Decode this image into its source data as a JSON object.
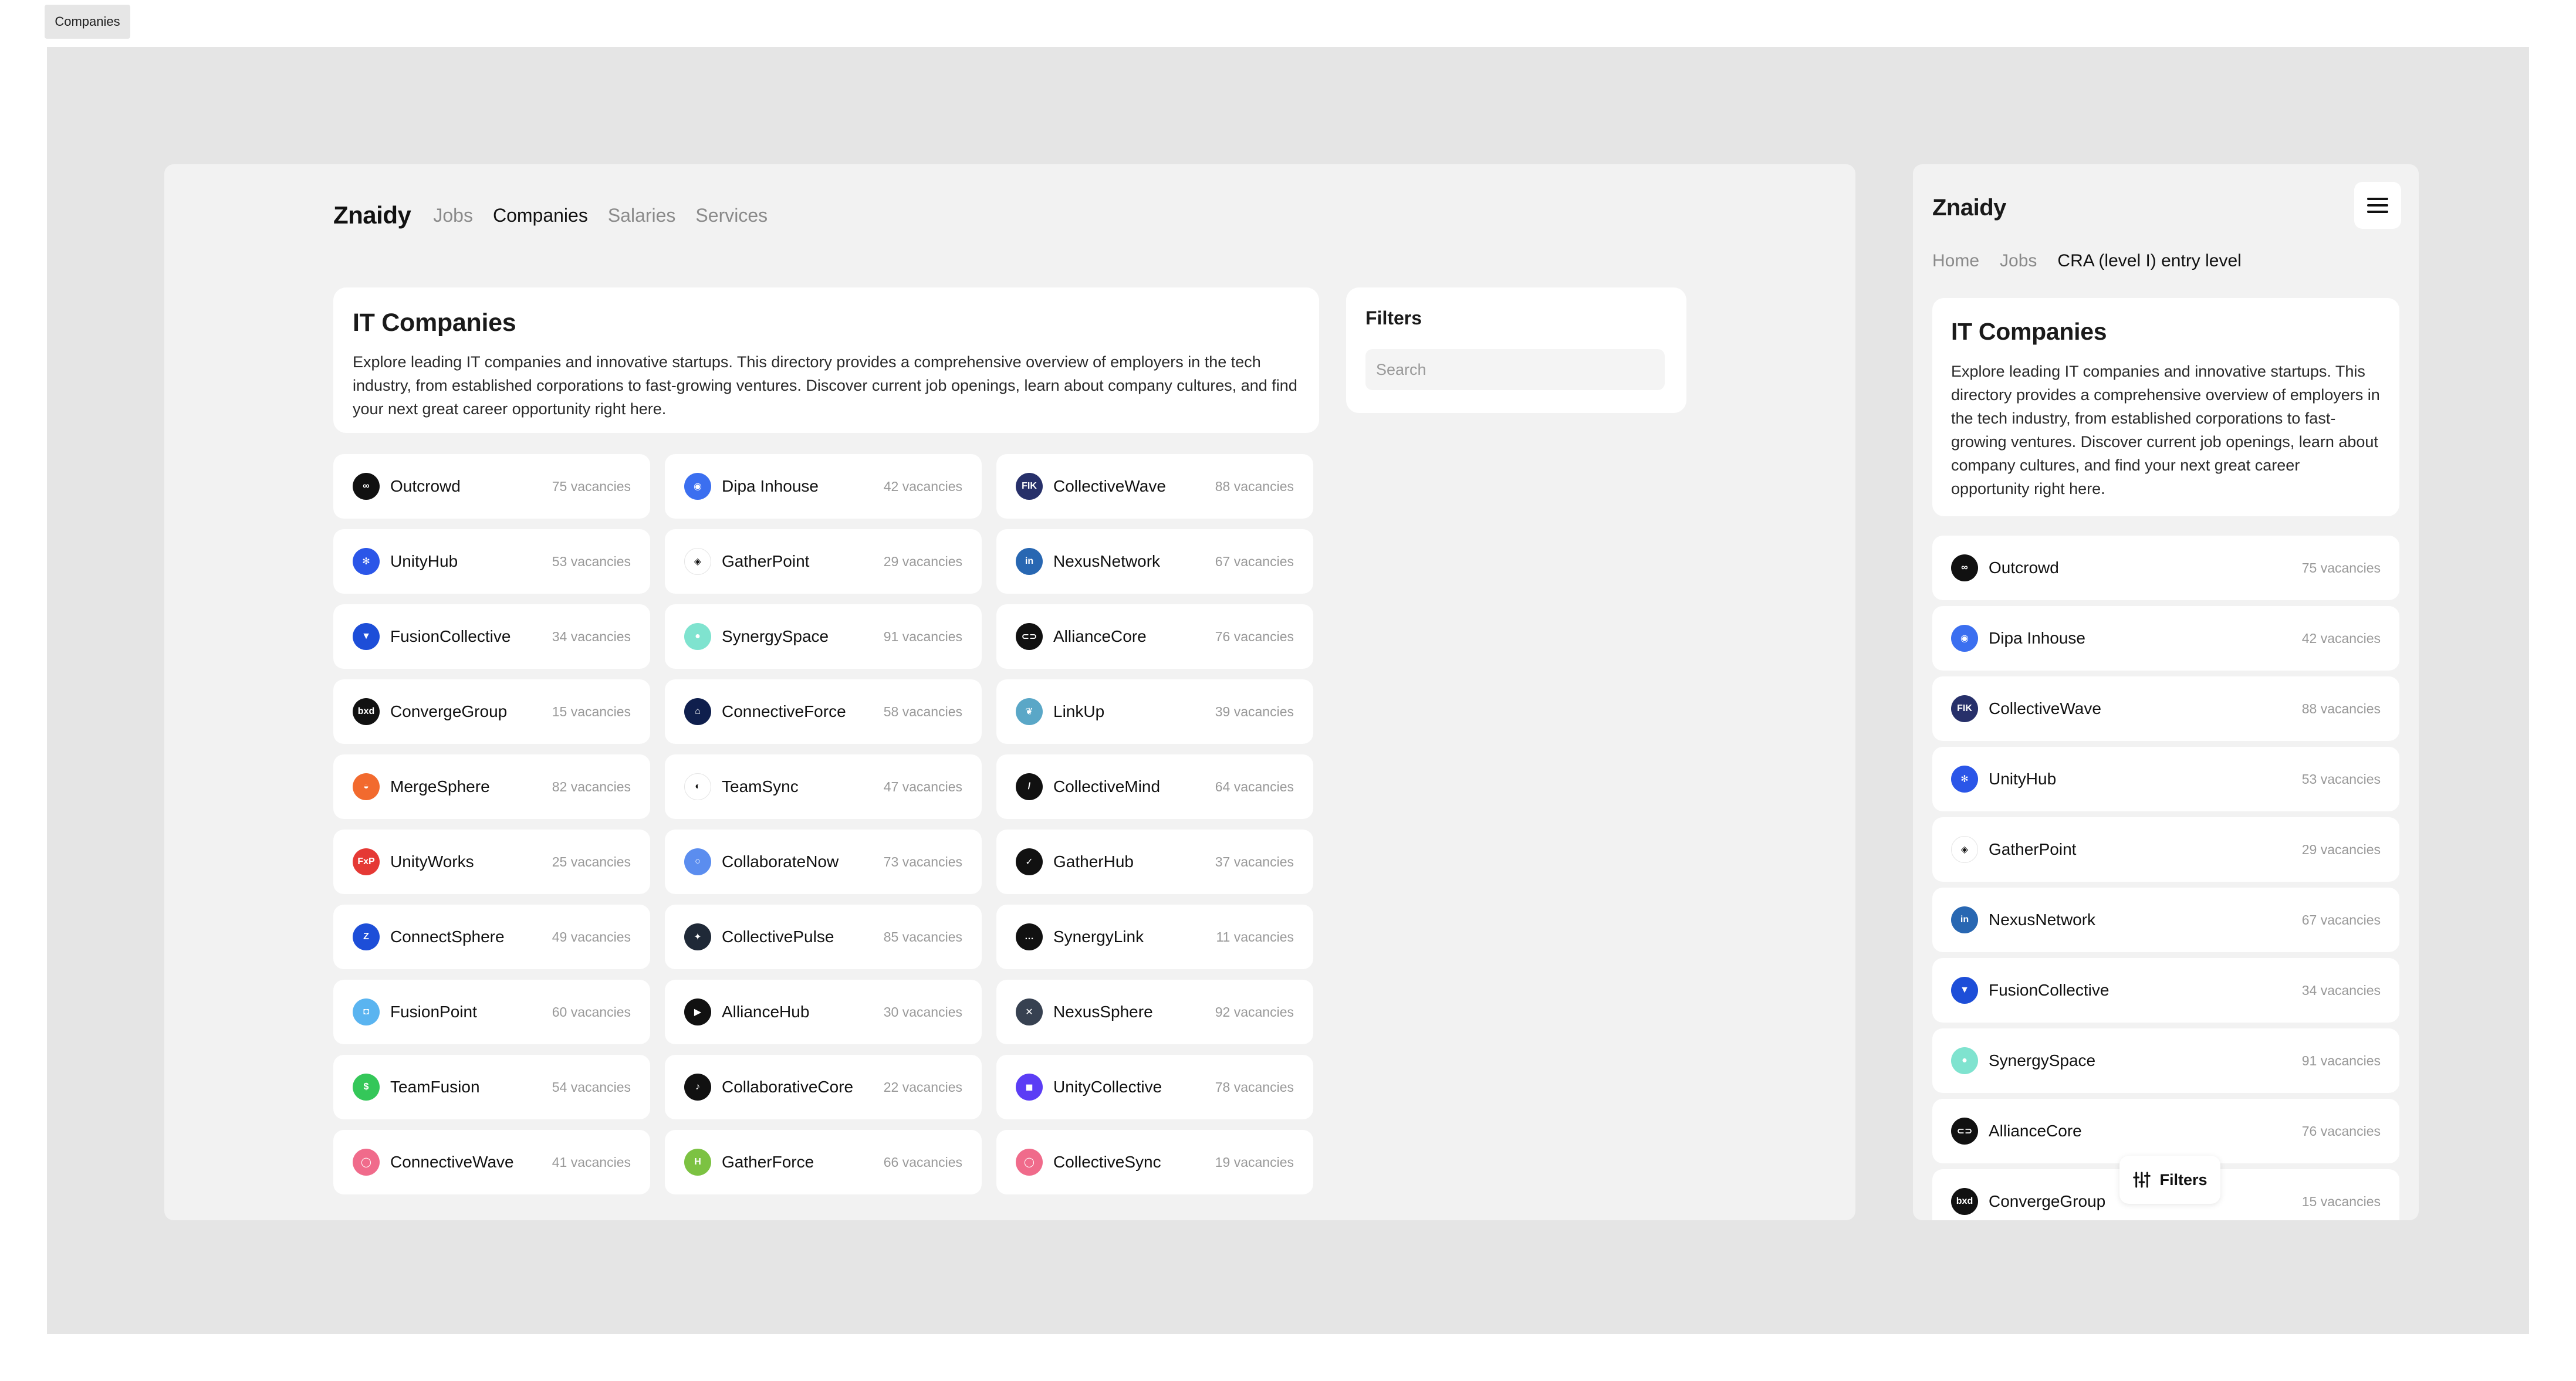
{
  "frame_label": "Companies",
  "desktop": {
    "logo": "Znaidy",
    "nav": [
      {
        "label": "Jobs",
        "active": false
      },
      {
        "label": "Companies",
        "active": true
      },
      {
        "label": "Salaries",
        "active": false
      },
      {
        "label": "Services",
        "active": false
      }
    ],
    "title": "IT Companies",
    "description": "Explore leading IT companies and innovative startups. This directory provides a comprehensive overview of employers in the tech industry, from established corporations to fast-growing ventures. Discover current job openings, learn about company cultures, and find your next great career opportunity right here.",
    "filters": {
      "title": "Filters",
      "search_placeholder": "Search"
    },
    "companies": [
      {
        "name": "Outcrowd",
        "vacancies": "75 vacancies",
        "icon": "infinity-logo-icon",
        "color": "#111111",
        "glyph": "∞"
      },
      {
        "name": "Dipa Inhouse",
        "vacancies": "42 vacancies",
        "icon": "ring-logo-icon",
        "color": "#3b6ff0",
        "glyph": "◉"
      },
      {
        "name": "CollectiveWave",
        "vacancies": "88 vacancies",
        "icon": "fik-logo-icon",
        "color": "#27306a",
        "glyph": "FIK"
      },
      {
        "name": "UnityHub",
        "vacancies": "53 vacancies",
        "icon": "asterisk-logo-icon",
        "color": "#2b56e8",
        "glyph": "✻"
      },
      {
        "name": "GatherPoint",
        "vacancies": "29 vacancies",
        "icon": "diamond-logo-icon",
        "color": "#ffffff",
        "glyph": "◈"
      },
      {
        "name": "NexusNetwork",
        "vacancies": "67 vacancies",
        "icon": "linkedin-logo-icon",
        "color": "#2867b2",
        "glyph": "in"
      },
      {
        "name": "FusionCollective",
        "vacancies": "34 vacancies",
        "icon": "shield-logo-icon",
        "color": "#1d4ed8",
        "glyph": "▼"
      },
      {
        "name": "SynergySpace",
        "vacancies": "91 vacancies",
        "icon": "mint-logo-icon",
        "color": "#7fe3cf",
        "glyph": "●"
      },
      {
        "name": "AllianceCore",
        "vacancies": "76 vacancies",
        "icon": "link-logo-icon",
        "color": "#111111",
        "glyph": "⊂⊃"
      },
      {
        "name": "ConvergeGroup",
        "vacancies": "15 vacancies",
        "icon": "text-logo-icon",
        "color": "#111111",
        "glyph": "bxd"
      },
      {
        "name": "ConnectiveForce",
        "vacancies": "58 vacancies",
        "icon": "mountain-logo-icon",
        "color": "#0f1f4d",
        "glyph": "⌂"
      },
      {
        "name": "LinkUp",
        "vacancies": "39 vacancies",
        "icon": "bird-logo-icon",
        "color": "#5aa7c7",
        "glyph": "❦"
      },
      {
        "name": "MergeSphere",
        "vacancies": "82 vacancies",
        "icon": "orange-logo-icon",
        "color": "#f26a2e",
        "glyph": "◒"
      },
      {
        "name": "TeamSync",
        "vacancies": "47 vacancies",
        "icon": "leaf-logo-icon",
        "color": "#ffffff",
        "glyph": "◐"
      },
      {
        "name": "CollectiveMind",
        "vacancies": "64 vacancies",
        "icon": "slash-logo-icon",
        "color": "#111111",
        "glyph": "/"
      },
      {
        "name": "UnityWorks",
        "vacancies": "25 vacancies",
        "icon": "red-logo-icon",
        "color": "#e53935",
        "glyph": "FxP"
      },
      {
        "name": "CollaborateNow",
        "vacancies": "73 vacancies",
        "icon": "gradient-logo-icon",
        "color": "#5b8def",
        "glyph": "○"
      },
      {
        "name": "GatherHub",
        "vacancies": "37 vacancies",
        "icon": "swoosh-logo-icon",
        "color": "#111111",
        "glyph": "✓"
      },
      {
        "name": "ConnectSphere",
        "vacancies": "49 vacancies",
        "icon": "blue-z-logo-icon",
        "color": "#1d4ed8",
        "glyph": "Z"
      },
      {
        "name": "CollectivePulse",
        "vacancies": "85 vacancies",
        "icon": "spark-logo-icon",
        "color": "#1f2937",
        "glyph": "✦"
      },
      {
        "name": "SynergyLink",
        "vacancies": "11 vacancies",
        "icon": "dark-logo-icon",
        "color": "#111111",
        "glyph": "…"
      },
      {
        "name": "FusionPoint",
        "vacancies": "60 vacancies",
        "icon": "bubble-logo-icon",
        "color": "#5ab4f0",
        "glyph": "◘"
      },
      {
        "name": "AllianceHub",
        "vacancies": "30 vacancies",
        "icon": "play-logo-icon",
        "color": "#111111",
        "glyph": "▶"
      },
      {
        "name": "NexusSphere",
        "vacancies": "92 vacancies",
        "icon": "cross-logo-icon",
        "color": "#374151",
        "glyph": "✕"
      },
      {
        "name": "TeamFusion",
        "vacancies": "54 vacancies",
        "icon": "dollar-logo-icon",
        "color": "#34c759",
        "glyph": "$"
      },
      {
        "name": "CollaborativeCore",
        "vacancies": "22 vacancies",
        "icon": "tiktok-logo-icon",
        "color": "#111111",
        "glyph": "♪"
      },
      {
        "name": "UnityCollective",
        "vacancies": "78 vacancies",
        "icon": "purple-logo-icon",
        "color": "#5b3df5",
        "glyph": "◼"
      },
      {
        "name": "ConnectiveWave",
        "vacancies": "41 vacancies",
        "icon": "pink-logo-icon",
        "color": "#f06b8b",
        "glyph": "◯"
      },
      {
        "name": "GatherForce",
        "vacancies": "66 vacancies",
        "icon": "h-logo-icon",
        "color": "#7cc242",
        "glyph": "H"
      },
      {
        "name": "CollectiveSync",
        "vacancies": "19 vacancies",
        "icon": "pink-logo-icon",
        "color": "#f06b8b",
        "glyph": "◯"
      }
    ]
  },
  "mobile": {
    "logo": "Znaidy",
    "breadcrumbs": [
      "Home",
      "Jobs",
      "CRA (level I) entry level"
    ],
    "title": "IT Companies",
    "description": "Explore leading IT companies and innovative startups. This directory provides a comprehensive overview of employers in the tech industry, from established corporations to fast-growing ventures. Discover current job openings, learn about company cultures, and find your next great career opportunity right here.",
    "fab_label": "Filters",
    "companies": [
      {
        "name": "Outcrowd",
        "vacancies": "75 vacancies",
        "icon": "infinity-logo-icon",
        "color": "#111111",
        "glyph": "∞"
      },
      {
        "name": "Dipa Inhouse",
        "vacancies": "42 vacancies",
        "icon": "ring-logo-icon",
        "color": "#3b6ff0",
        "glyph": "◉"
      },
      {
        "name": "CollectiveWave",
        "vacancies": "88 vacancies",
        "icon": "fik-logo-icon",
        "color": "#27306a",
        "glyph": "FIK"
      },
      {
        "name": "UnityHub",
        "vacancies": "53 vacancies",
        "icon": "asterisk-logo-icon",
        "color": "#2b56e8",
        "glyph": "✻"
      },
      {
        "name": "GatherPoint",
        "vacancies": "29 vacancies",
        "icon": "diamond-logo-icon",
        "color": "#ffffff",
        "glyph": "◈"
      },
      {
        "name": "NexusNetwork",
        "vacancies": "67 vacancies",
        "icon": "linkedin-logo-icon",
        "color": "#2867b2",
        "glyph": "in"
      },
      {
        "name": "FusionCollective",
        "vacancies": "34 vacancies",
        "icon": "shield-logo-icon",
        "color": "#1d4ed8",
        "glyph": "▼"
      },
      {
        "name": "SynergySpace",
        "vacancies": "91 vacancies",
        "icon": "mint-logo-icon",
        "color": "#7fe3cf",
        "glyph": "●"
      },
      {
        "name": "AllianceCore",
        "vacancies": "76 vacancies",
        "icon": "link-logo-icon",
        "color": "#111111",
        "glyph": "⊂⊃"
      },
      {
        "name": "ConvergeGroup",
        "vacancies": "15 vacancies",
        "icon": "text-logo-icon",
        "color": "#111111",
        "glyph": "bxd"
      }
    ]
  }
}
